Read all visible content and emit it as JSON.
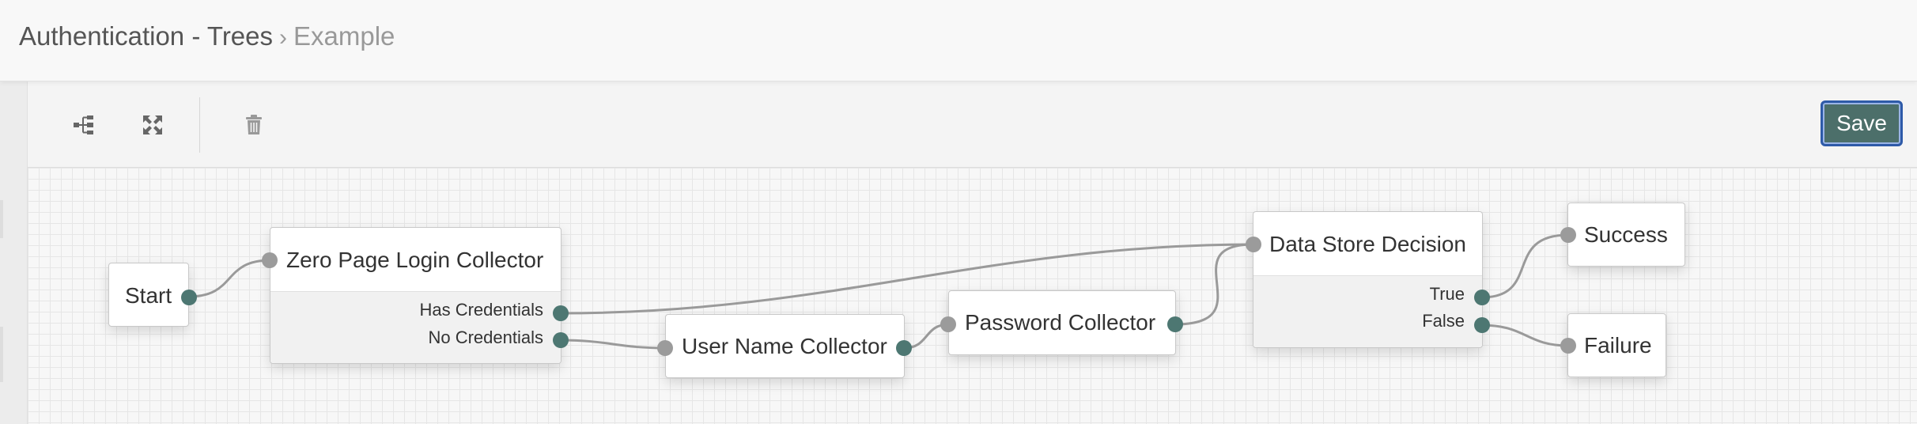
{
  "header": {
    "breadcrumb_parent": "Authentication - Trees",
    "breadcrumb_separator": "›",
    "breadcrumb_current": "Example"
  },
  "toolbar": {
    "layout_icon": "tree-layout-icon",
    "fullscreen_icon": "expand-icon",
    "delete_icon": "trash-icon",
    "save_label": "Save"
  },
  "colors": {
    "save_button": "#4c6f6a",
    "save_border": "#2e5aa8",
    "output_port": "#4d7772",
    "input_port": "#9b9b9b",
    "edge": "#9a9a9a"
  },
  "tree": {
    "nodes": {
      "start": {
        "title": "Start"
      },
      "zero_page": {
        "title": "Zero Page Login Collector",
        "outcomes": [
          "Has Credentials",
          "No Credentials"
        ]
      },
      "username": {
        "title": "User Name Collector"
      },
      "password": {
        "title": "Password Collector"
      },
      "data_store": {
        "title": "Data Store Decision",
        "outcomes": [
          "True",
          "False"
        ]
      },
      "success": {
        "title": "Success"
      },
      "failure": {
        "title": "Failure"
      }
    }
  }
}
